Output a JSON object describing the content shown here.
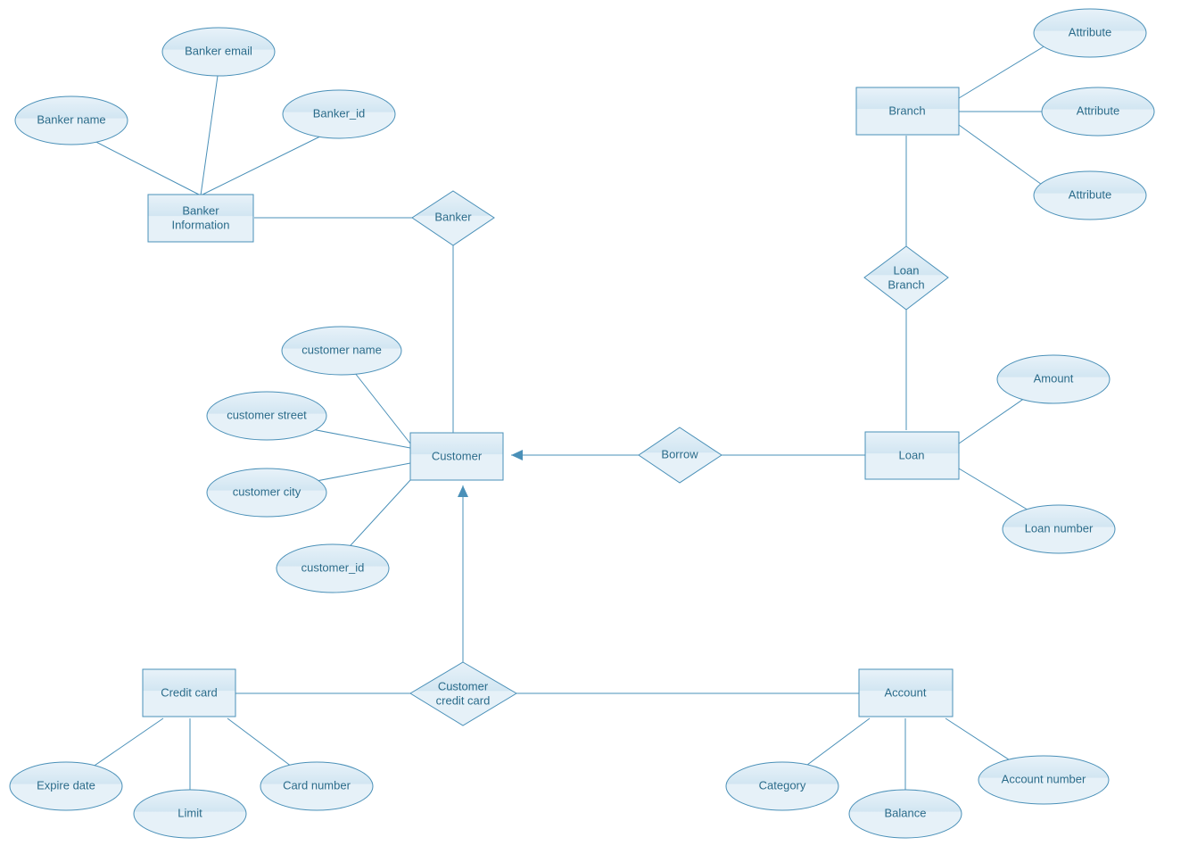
{
  "entities": {
    "bankerInfo": "Banker\nInformation",
    "customer": "Customer",
    "creditCard": "Credit card",
    "branch": "Branch",
    "loan": "Loan",
    "account": "Account"
  },
  "relationships": {
    "banker": "Banker",
    "borrow": "Borrow",
    "loanBranch": "Loan\nBranch",
    "customerCreditCard": "Customer\ncredit card"
  },
  "attributes": {
    "bankerName": "Banker name",
    "bankerEmail": "Banker email",
    "bankerId": "Banker_id",
    "customerName": "customer name",
    "customerStreet": "customer street",
    "customerCity": "customer city",
    "customerId": "customer_id",
    "branchAttr1": "Attribute",
    "branchAttr2": "Attribute",
    "branchAttr3": "Attribute",
    "amount": "Amount",
    "loanNumber": "Loan number",
    "expireDate": "Expire date",
    "limit": "Limit",
    "cardNumber": "Card number",
    "category": "Category",
    "balance": "Balance",
    "accountNumber": "Account number"
  }
}
